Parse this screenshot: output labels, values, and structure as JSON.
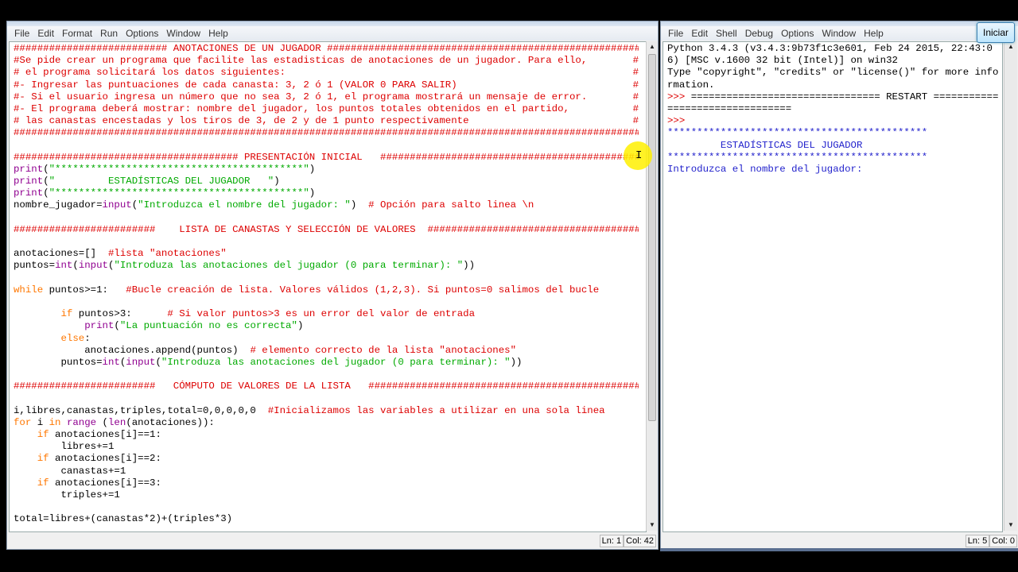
{
  "editor": {
    "menu": [
      "File",
      "Edit",
      "Format",
      "Run",
      "Options",
      "Window",
      "Help"
    ],
    "status": {
      "line": "Ln: 1",
      "col": "Col: 42"
    },
    "lines": [
      [
        [
          "c",
          "########################## ANOTACIONES DE UN JUGADOR ############################################################"
        ]
      ],
      [
        [
          "c",
          "#Se pide crear un programa que facilite las estadisticas de anotaciones de un jugador. Para ello,"
        ],
        [
          "cr",
          "#"
        ]
      ],
      [
        [
          "c",
          "# el programa solicitará los datos siguientes:"
        ],
        [
          "cr",
          "#"
        ]
      ],
      [
        [
          "c",
          "#- Ingresar las puntuaciones de cada canasta: 3, 2 ó 1 (VALOR 0 PARA SALIR)"
        ],
        [
          "cr",
          "#"
        ]
      ],
      [
        [
          "c",
          "#- Si el usuario ingresa un número que no sea 3, 2 ó 1, el programa mostrará un mensaje de error."
        ],
        [
          "cr",
          "#"
        ]
      ],
      [
        [
          "c",
          "#- El programa deberá mostrar: nombre del jugador, los puntos totales obtenidos en el partido,"
        ],
        [
          "cr",
          "#"
        ]
      ],
      [
        [
          "c",
          "# las canastas encestadas y los tiros de 3, de 2 y de 1 punto respectivamente"
        ],
        [
          "cr",
          "#"
        ]
      ],
      [
        [
          "c",
          "################################################################################################################"
        ]
      ],
      [],
      [
        [
          "c",
          "###################################### PRESENTACIÓN INICIAL   ##############################################"
        ]
      ],
      [
        [
          "b",
          "print"
        ],
        [
          "d",
          "("
        ],
        [
          "s",
          "\"******************************************\""
        ],
        [
          "d",
          ")"
        ]
      ],
      [
        [
          "b",
          "print"
        ],
        [
          "d",
          "("
        ],
        [
          "s",
          "\"         ESTADÍSTICAS DEL JUGADOR   \""
        ],
        [
          "d",
          ")"
        ]
      ],
      [
        [
          "b",
          "print"
        ],
        [
          "d",
          "("
        ],
        [
          "s",
          "\"******************************************\""
        ],
        [
          "d",
          ")"
        ]
      ],
      [
        [
          "d",
          "nombre_jugador="
        ],
        [
          "b",
          "input"
        ],
        [
          "d",
          "("
        ],
        [
          "s",
          "\"Introduzca el nombre del jugador: \""
        ],
        [
          "d",
          ")  "
        ],
        [
          "c",
          "# Opción para salto linea \\n"
        ]
      ],
      [],
      [
        [
          "c",
          "########################    LISTA DE CANASTAS Y SELECCIÓN DE VALORES  ######################################"
        ]
      ],
      [],
      [
        [
          "d",
          "anotaciones=[]  "
        ],
        [
          "c",
          "#lista \"anotaciones\""
        ]
      ],
      [
        [
          "d",
          "puntos="
        ],
        [
          "b",
          "int"
        ],
        [
          "d",
          "("
        ],
        [
          "b",
          "input"
        ],
        [
          "d",
          "("
        ],
        [
          "s",
          "\"Introduza las anotaciones del jugador (0 para terminar): \""
        ],
        [
          "d",
          "))"
        ]
      ],
      [],
      [
        [
          "k",
          "while"
        ],
        [
          "d",
          " puntos>=1:   "
        ],
        [
          "c",
          "#Bucle creación de lista. Valores válidos (1,2,3). Si puntos=0 salimos del bucle"
        ]
      ],
      [],
      [
        [
          "d",
          "        "
        ],
        [
          "k",
          "if"
        ],
        [
          "d",
          " puntos>3:      "
        ],
        [
          "c",
          "# Si valor puntos>3 es un error del valor de entrada"
        ]
      ],
      [
        [
          "d",
          "            "
        ],
        [
          "b",
          "print"
        ],
        [
          "d",
          "("
        ],
        [
          "s",
          "\"La puntuación no es correcta\""
        ],
        [
          "d",
          ")"
        ]
      ],
      [
        [
          "d",
          "        "
        ],
        [
          "k",
          "else"
        ],
        [
          "d",
          ":"
        ]
      ],
      [
        [
          "d",
          "            anotaciones.append(puntos)  "
        ],
        [
          "c",
          "# elemento correcto de la lista \"anotaciones\""
        ]
      ],
      [
        [
          "d",
          "        puntos="
        ],
        [
          "b",
          "int"
        ],
        [
          "d",
          "("
        ],
        [
          "b",
          "input"
        ],
        [
          "d",
          "("
        ],
        [
          "s",
          "\"Introduza las anotaciones del jugador (0 para terminar): \""
        ],
        [
          "d",
          "))"
        ]
      ],
      [],
      [
        [
          "c",
          "########################   CÓMPUTO DE VALORES DE LA LISTA   ##############################################"
        ]
      ],
      [],
      [
        [
          "d",
          "i,libres,canastas,triples,total=0,0,0,0,0  "
        ],
        [
          "c",
          "#Inicializamos las variables a utilizar en una sola linea"
        ]
      ],
      [
        [
          "k",
          "for"
        ],
        [
          "d",
          " i "
        ],
        [
          "k",
          "in"
        ],
        [
          "d",
          " "
        ],
        [
          "b",
          "range"
        ],
        [
          "d",
          " ("
        ],
        [
          "b",
          "len"
        ],
        [
          "d",
          "(anotaciones)):"
        ]
      ],
      [
        [
          "d",
          "    "
        ],
        [
          "k",
          "if"
        ],
        [
          "d",
          " anotaciones[i]==1:"
        ]
      ],
      [
        [
          "d",
          "        libres+=1"
        ]
      ],
      [
        [
          "d",
          "    "
        ],
        [
          "k",
          "if"
        ],
        [
          "d",
          " anotaciones[i]==2:"
        ]
      ],
      [
        [
          "d",
          "        canastas+=1"
        ]
      ],
      [
        [
          "d",
          "    "
        ],
        [
          "k",
          "if"
        ],
        [
          "d",
          " anotaciones[i]==3:"
        ]
      ],
      [
        [
          "d",
          "        triples+=1"
        ]
      ],
      [],
      [
        [
          "d",
          "total=libres+(canastas*2)+(triples*3)"
        ]
      ]
    ]
  },
  "shell": {
    "menu": [
      "File",
      "Edit",
      "Shell",
      "Debug",
      "Options",
      "Window",
      "Help"
    ],
    "status": {
      "line": "Ln: 5",
      "col": "Col: 0"
    },
    "lines": [
      [
        [
          "d",
          "Python 3.4.3 (v3.4.3:9b73f1c3e601, Feb 24 2015, 22:43:06) [MSC v.1600 32 bit (Intel)] on win32"
        ]
      ],
      [
        [
          "d",
          "Type \"copyright\", \"credits\" or \"license()\" for more information."
        ]
      ],
      [
        [
          "c",
          ">>> "
        ],
        [
          "d",
          "================================ RESTART ================================"
        ]
      ],
      [
        [
          "c",
          ">>> "
        ]
      ],
      [
        [
          "o",
          "********************************************"
        ]
      ],
      [
        [
          "o",
          "         ESTADÍSTICAS DEL JUGADOR   "
        ]
      ],
      [
        [
          "o",
          "********************************************"
        ]
      ],
      [
        [
          "o",
          "Introduzca el nombre del jugador: "
        ]
      ]
    ]
  },
  "taskbar": {
    "start_label": "Iniciar"
  }
}
